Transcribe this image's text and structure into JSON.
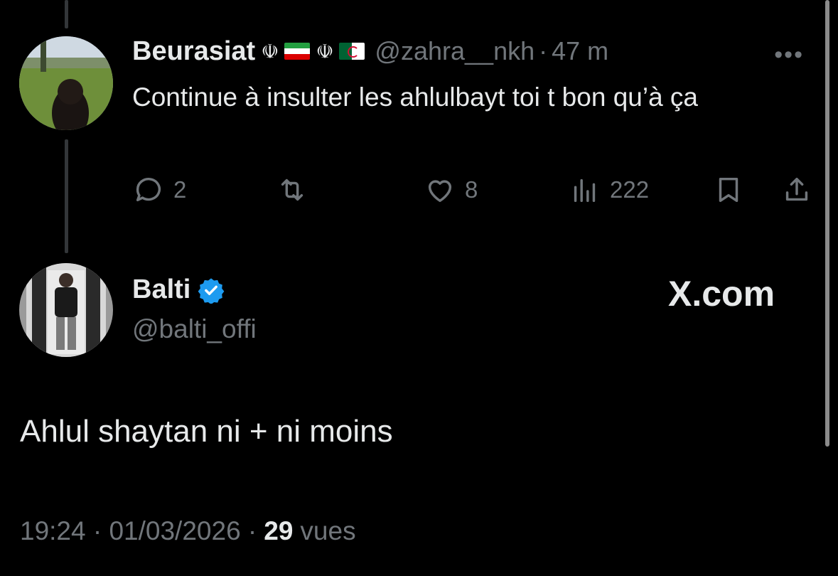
{
  "reply": {
    "display_name": "Beurasiat",
    "handle": "@zahra__nkh",
    "separator": "·",
    "time": "47 m",
    "text": "Continue à insulter les ahlulbayt toi t bon qu’à ça",
    "more": "•••",
    "emblem": "☫",
    "actions": {
      "replies": "2",
      "retweets": "",
      "likes": "8",
      "views": "222"
    }
  },
  "main": {
    "display_name": "Balti",
    "handle": "@balti_offi",
    "text": "Ahlul shaytan ni + ni moins",
    "date": "19:24 · 01/03/2026 ·",
    "views_count": "29",
    "views_label": "vues"
  },
  "watermark": "X.com",
  "colors": {
    "background": "#000000",
    "text": "#e7e9ea",
    "muted": "#71767b",
    "verified": "#1d9bf0"
  }
}
